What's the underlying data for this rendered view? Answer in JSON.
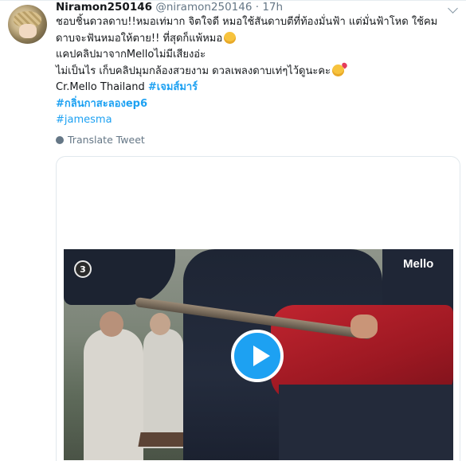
{
  "tweet": {
    "display_name": "Niramon250146",
    "handle": "@niramon250146",
    "separator": "·",
    "time": "17h",
    "lines": [
      "ชอบชิ้นดวลดาบ!!หมอเท่มาก จิตใจดี หมอใช้สันดาบตีที่ท้องมั่นฟ้า แต่มั่นฟ้าโหด ใช้คม",
      "ดาบจะฟันหมอให้ตาย!! ที่สุดก็แพ้หมอ",
      "แคปคลิปมาจากMelloไม่มีเสียงอ่ะ",
      "ไม่เป็นไร เก็บคลิปมุมกล้องสวยงาม ดวลเพลงดาบเท่ๆไว้ดูนะคะ"
    ],
    "credit_prefix": "Cr.Mello Thailand",
    "credit_tag": "#เจมส์มาร์",
    "hashtags": [
      "#กลิ่นกาสะลองep6",
      "#jamesma"
    ],
    "emojis": [
      "smiling-face-icon",
      "face-blowing-kiss-icon"
    ],
    "translate_label": "Translate Tweet"
  },
  "video": {
    "channel_logo": "3",
    "watermark": "Mello",
    "play_icon": "play-icon",
    "accent_color": "#1da1f2"
  }
}
